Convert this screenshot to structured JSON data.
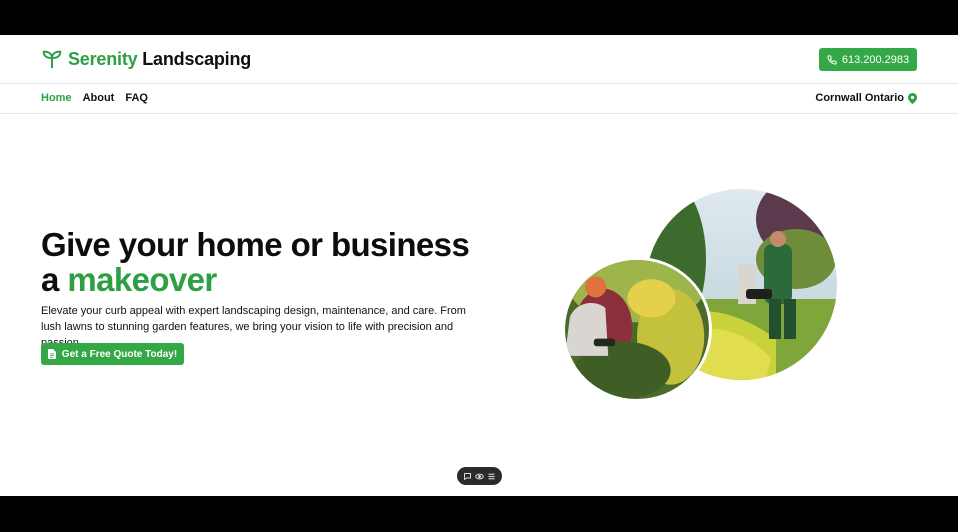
{
  "brand": {
    "name_green": "Serenity",
    "name_black": "Landscaping",
    "icon": "sprout-icon",
    "color": "#2ea043"
  },
  "header": {
    "phone_label": "613.200.2983",
    "phone_icon": "phone-icon"
  },
  "nav": {
    "items": [
      {
        "label": "Home",
        "active": true
      },
      {
        "label": "About",
        "active": false
      },
      {
        "label": "FAQ",
        "active": false
      }
    ],
    "location_label": "Cornwall Ontario",
    "location_icon": "map-pin-icon"
  },
  "hero": {
    "title_line1": "Give your home or business",
    "title_line2_prefix": "a ",
    "title_line2_highlight": "makeover",
    "description": "Elevate your curb appeal with expert landscaping design, maintenance, and care. From lush lawns to stunning garden features, we bring your vision to life with precision and passion.",
    "cta_label": "Get a Free Quote Today!",
    "cta_icon": "document-icon"
  },
  "images": {
    "back": "gardener-trimming-hedge-photo",
    "front": "gardener-planting-flowers-photo"
  },
  "floating_toolbar": {
    "icons": [
      "comment-icon",
      "eye-icon",
      "menu-icon"
    ]
  },
  "colors": {
    "accent": "#34a846",
    "text": "#111111"
  }
}
